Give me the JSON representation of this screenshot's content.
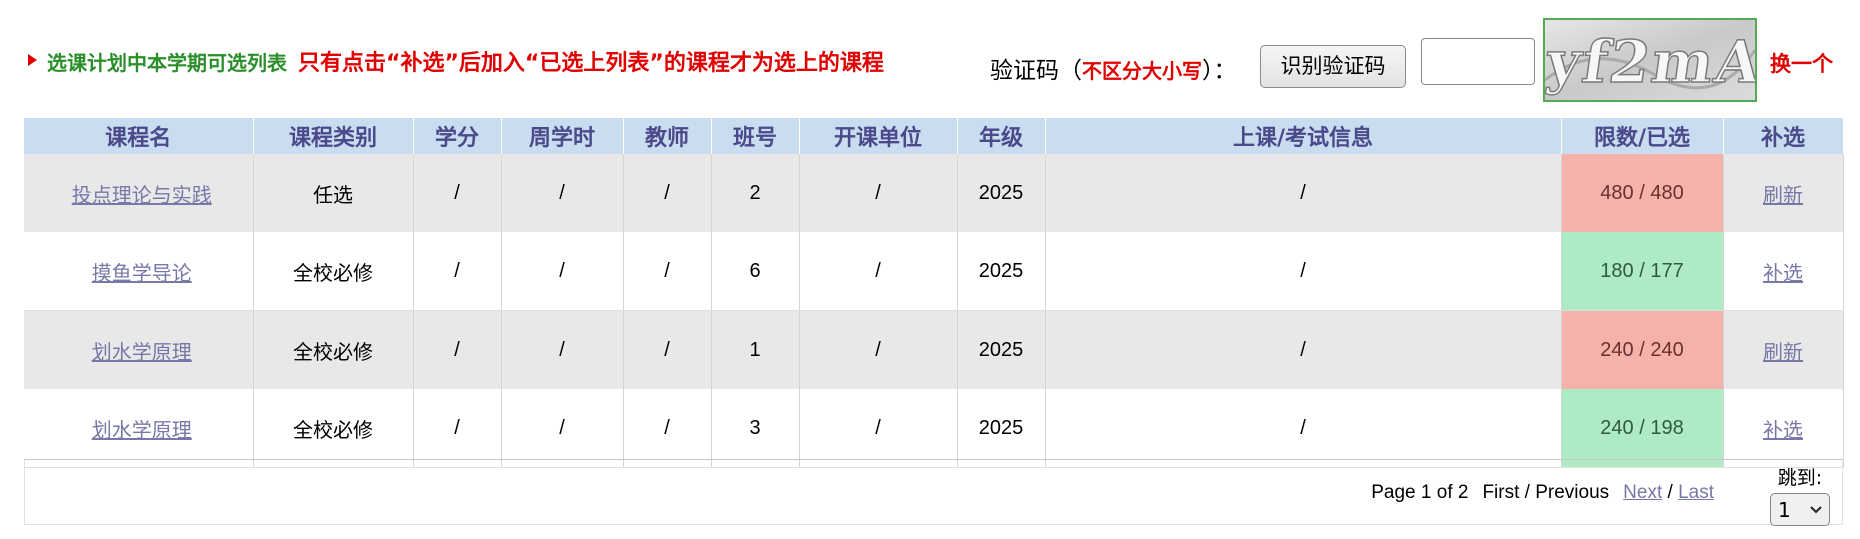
{
  "header": {
    "title": "选课计划中本学期可选列表",
    "notice": "只有点击“补选”后加入“已选上列表”的课程才为选上的课程",
    "captcha_label": "验证码（",
    "captcha_hint": "不区分大小写",
    "captcha_label_end": "）：",
    "recognize_button": "识别验证码",
    "captcha_input_value": "",
    "captcha_text": "yf2mA",
    "change_link": "换一个"
  },
  "table": {
    "columns": [
      "课程名",
      "课程类别",
      "学分",
      "周学时",
      "教师",
      "班号",
      "开课单位",
      "年级",
      "上课/考试信息",
      "限数/已选",
      "补选"
    ],
    "rows": [
      {
        "name": "投点理论与实践",
        "category": "任选",
        "credit": "/",
        "hours": "/",
        "teacher": "/",
        "class_no": "2",
        "unit": "/",
        "grade": "2025",
        "info": "/",
        "quota": "480 / 480",
        "status": "full",
        "action": "刷新"
      },
      {
        "name": "摸鱼学导论",
        "category": "全校必修",
        "credit": "/",
        "hours": "/",
        "teacher": "/",
        "class_no": "6",
        "unit": "/",
        "grade": "2025",
        "info": "/",
        "quota": "180 / 177",
        "status": "open",
        "action": "补选"
      },
      {
        "name": "划水学原理",
        "category": "全校必修",
        "credit": "/",
        "hours": "/",
        "teacher": "/",
        "class_no": "1",
        "unit": "/",
        "grade": "2025",
        "info": "/",
        "quota": "240 / 240",
        "status": "full",
        "action": "刷新"
      },
      {
        "name": "划水学原理",
        "category": "全校必修",
        "credit": "/",
        "hours": "/",
        "teacher": "/",
        "class_no": "3",
        "unit": "/",
        "grade": "2025",
        "info": "/",
        "quota": "240 / 198",
        "status": "open",
        "action": "补选"
      }
    ]
  },
  "pagination": {
    "page_info": "Page 1 of 2",
    "first": "First",
    "separator": "/",
    "previous": "Previous",
    "next": "Next",
    "last": "Last",
    "jump_label": "跳到:",
    "jump_value": "1"
  },
  "colors": {
    "header_bg": "#c9dcf0",
    "full_quota": "#f4b2aa",
    "open_quota": "#aeebc4",
    "notice_red": "#e00000",
    "title_green": "#2a8f2a"
  }
}
